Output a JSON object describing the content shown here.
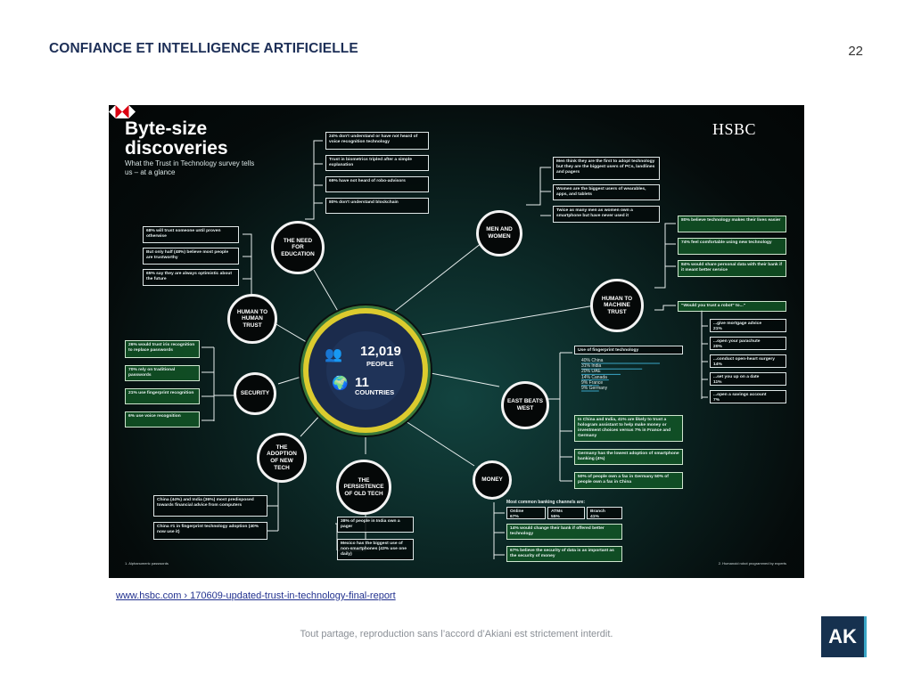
{
  "slide": {
    "title": "CONFIANCE ET INTELLIGENCE ARTIFICIELLE",
    "page_number": "22",
    "source_link": "www.hsbc.com › 170609-updated-trust-in-technology-final-report",
    "footer": "Tout partage, reproduction sans l’accord d’Akiani est strictement interdit.",
    "logo_text": "AK",
    "logo_color": "#16314f",
    "accent_color": "#3aa6c7"
  },
  "infographic": {
    "title_line1": "Byte-size",
    "title_line2": "discoveries",
    "subtitle": "What the Trust in Technology survey tells us – at a glance",
    "brand": "HSBC",
    "center": {
      "people_value": "12,019",
      "people_label": "PEOPLE",
      "countries_value": "11",
      "countries_label": "COUNTRIES"
    },
    "nodes": {
      "need_for_education": "THE NEED FOR EDUCATION",
      "men_and_women": "MEN AND WOMEN",
      "human_to_machine": "HUMAN TO MACHINE TRUST",
      "human_to_human": "HUMAN TO HUMAN TRUST",
      "security": "SECURITY",
      "east_beats_west": "EAST BEATS WEST",
      "adoption": "THE ADOPTION OF NEW TECH",
      "persistence": "THE PERSISTENCE OF OLD TECH",
      "money": "MONEY"
    },
    "education_boxes": [
      "24% don't understand or have not heard of voice recognition technology",
      "Trust in biometrics tripled after a simple explanation",
      "69% have not heard of robo-advisors",
      "80% don't understand blockchain"
    ],
    "human_boxes": [
      "68% will trust someone until proven otherwise",
      "But only half (48%) believe most people are trustworthy",
      "65% say they are always optimistic about the future"
    ],
    "security_boxes": [
      "26% would trust iris recognition to replace passwords",
      "70% rely on traditional passwords",
      "21% use fingerprint recognition",
      "6% use voice recognition"
    ],
    "men_boxes": [
      "Men think they are the first to adopt technology but they are the biggest users of PCs, landlines and pagers",
      "Women are the biggest users of wearables, apps, and tablets",
      "Twice as many men as women own a smartphone but have never used it"
    ],
    "machine_boxes": [
      "80% believe technology makes their lives easier",
      "74% feel comfortable using new technology",
      "84% would share personal data with their bank if it meant better service"
    ],
    "robot_question": "\"Would you trust a robot\" to...\"",
    "robot_boxes": [
      {
        "label": "...give mortgage advice",
        "value": "21%"
      },
      {
        "label": "...open your parachute",
        "value": "20%"
      },
      {
        "label": "...conduct open-heart surgery",
        "value": "14%"
      },
      {
        "label": "...set you up on a date",
        "value": "11%"
      },
      {
        "label": "...open a savings account",
        "value": "7%"
      }
    ],
    "fingerprint": {
      "heading": "Use of fingerprint technology",
      "rows": [
        {
          "label": "40% China",
          "value": 40
        },
        {
          "label": "31% India",
          "value": 31
        },
        {
          "label": "20% UAE",
          "value": 20
        },
        {
          "label": "14% Canada",
          "value": 14
        },
        {
          "label": "9% France",
          "value": 9
        },
        {
          "label": "9% Germany",
          "value": 9
        }
      ]
    },
    "east_boxes": [
      "In China and India, 41% are likely to trust a hologram assistant to help make money or investment choices versus 7% in France and Germany",
      "Germany has the lowest adoption of smartphone banking (4%)",
      "50% of people own a fax in Germany 50% of people own a fax in China"
    ],
    "adoption_boxes": [
      "China (44%) and India (36%) most predisposed towards financial advice from computers",
      "China #1 in fingerprint technology adoption (40% now use it)"
    ],
    "persistence_boxes": [
      "38% of people in India own a pager",
      "Mexico has the biggest use of non-smartphones (43% use one daily)"
    ],
    "money": {
      "channels_heading": "Most common banking channels are:",
      "channels": [
        {
          "label": "Online",
          "value": "67%"
        },
        {
          "label": "ATMs",
          "value": "55%"
        },
        {
          "label": "Branch",
          "value": "41%"
        }
      ],
      "boxes": [
        "14% would change their bank if offered better technology",
        "67% believe the security of data is as important as the security of money"
      ]
    },
    "footnote_left": "1. Alphanumeric passwords",
    "footnote_right": "2. Humanoid robot programmed by experts"
  }
}
